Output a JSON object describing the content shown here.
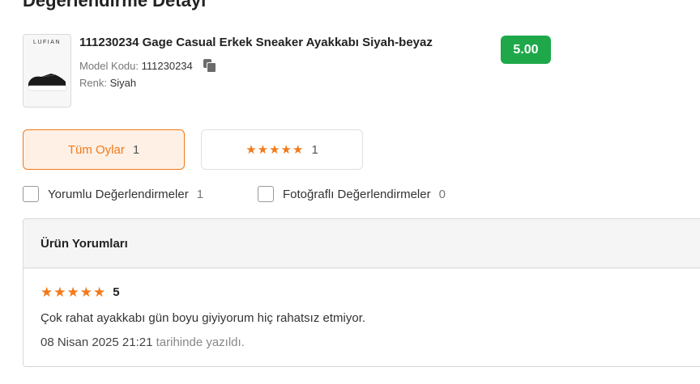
{
  "page": {
    "heading": "Değerlendirme Detayı"
  },
  "product": {
    "brand_logo_text": "LUFIAN",
    "title": "111230234 Gage Casual Erkek Sneaker Ayakkabı Siyah-beyaz",
    "score": "5.00",
    "model_label": "Model Kodu:",
    "model_value": "111230234",
    "color_label": "Renk:",
    "color_value": "Siyah",
    "icons": {
      "copy": "copy-icon"
    }
  },
  "filters": {
    "all": {
      "label": "Tüm Oylar",
      "count": "1"
    },
    "five_star": {
      "stars": 5,
      "count": "1"
    }
  },
  "checkboxes": [
    {
      "label": "Yorumlu Değerlendirmeler",
      "count": "1",
      "checked": false
    },
    {
      "label": "Fotoğraflı Değerlendirmeler",
      "count": "0",
      "checked": false
    }
  ],
  "reviews": {
    "header": "Ürün Yorumları",
    "items": [
      {
        "stars": 5,
        "rating": "5",
        "text": "Çok rahat ayakkabı gün boyu giyiyorum hiç rahatsız etmiyor.",
        "date": "08 Nisan 2025 21:21",
        "date_suffix": "tarihinde yazıldı."
      }
    ]
  },
  "colors": {
    "accent": "#f27a1a",
    "accent_bg": "#fef0e4",
    "score_badge": "#1ea84a",
    "star": "#f27a1a"
  }
}
